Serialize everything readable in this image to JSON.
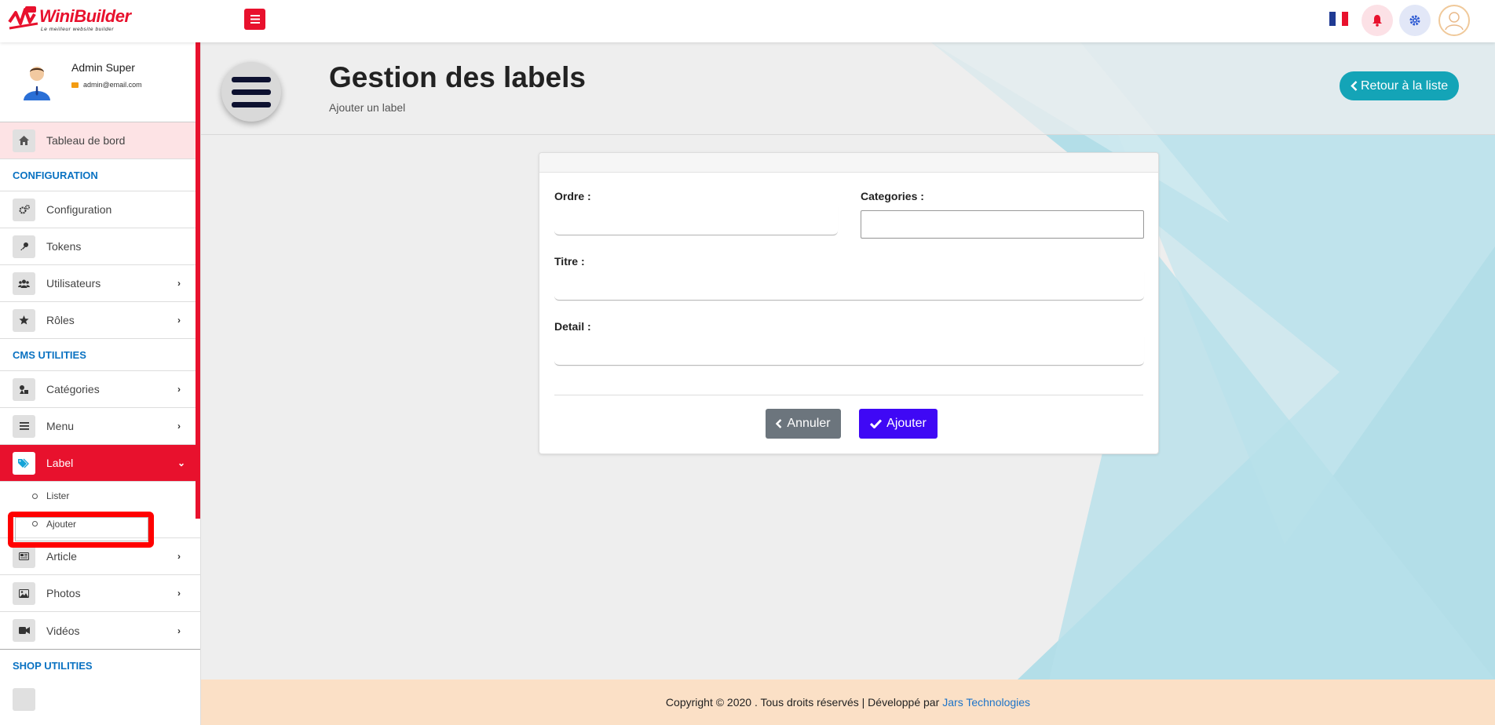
{
  "brand": {
    "logo_name": "WiniBuilder",
    "tagline": "Le meilleur website builder"
  },
  "topbar": {
    "menu_icon": "hamburger-icon",
    "flag": "france-flag",
    "notification_icon": "bell-icon",
    "settings_icon": "gear-icon",
    "user_icon": "user-avatar-icon"
  },
  "profile": {
    "name": "Admin Super",
    "email": "admin@email.com"
  },
  "sidebar": {
    "dashboard": {
      "label": "Tableau de bord",
      "icon": "home-icon"
    },
    "sections": [
      {
        "title": "CONFIGURATION",
        "items": [
          {
            "label": "Configuration",
            "icon": "cogs-icon",
            "chevron": ""
          },
          {
            "label": "Tokens",
            "icon": "key-icon",
            "chevron": ""
          },
          {
            "label": "Utilisateurs",
            "icon": "users-icon",
            "chevron": "›"
          },
          {
            "label": "Rôles",
            "icon": "star-icon",
            "chevron": "›"
          }
        ]
      },
      {
        "title": "CMS UTILITIES",
        "items": [
          {
            "label": "Catégories",
            "icon": "shapes-icon",
            "chevron": "›"
          },
          {
            "label": "Menu",
            "icon": "bars-icon",
            "chevron": "›"
          },
          {
            "label": "Label",
            "icon": "tag-icon",
            "chevron": "⌄",
            "active": true
          }
        ],
        "sub_items": [
          {
            "label": "Lister"
          },
          {
            "label": "Ajouter"
          }
        ],
        "more_items": [
          {
            "label": "Article",
            "icon": "newspaper-icon",
            "chevron": "›"
          },
          {
            "label": "Photos",
            "icon": "image-icon",
            "chevron": "›"
          },
          {
            "label": "Vidéos",
            "icon": "video-icon",
            "chevron": "›"
          }
        ]
      },
      {
        "title": "SHOP UTILITIES"
      }
    ]
  },
  "header": {
    "title": "Gestion des labels",
    "subtitle": "Ajouter un label",
    "back_button": "Retour à la liste"
  },
  "form": {
    "ordre_label": "Ordre :",
    "ordre_value": "",
    "categories_label": "Categories :",
    "categories_value": "",
    "titre_label": "Titre :",
    "titre_value": "",
    "detail_label": "Detail :",
    "detail_value": "",
    "cancel_button": "Annuler",
    "submit_button": "Ajouter"
  },
  "footer": {
    "text": "Copyright © 2020 . Tous droits réservés | Développé par",
    "link": "Jars Technologies"
  },
  "colors": {
    "accent_red": "#e8112d",
    "teal": "#14a4b7",
    "submit_blue": "#3f08f5",
    "section_blue": "#0a72c2",
    "footer_bg": "#fbe0c6"
  }
}
